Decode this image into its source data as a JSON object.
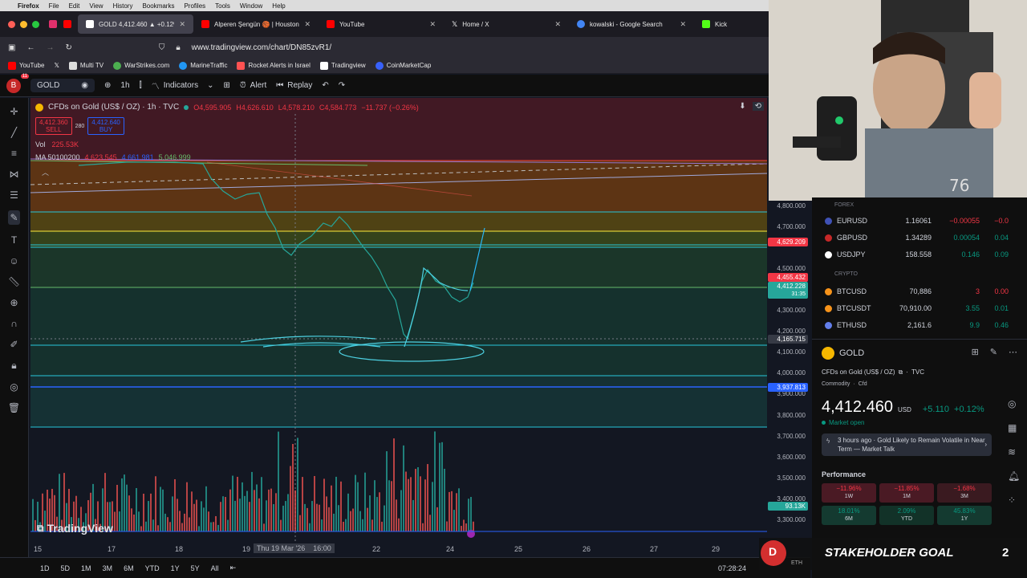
{
  "menubar": {
    "app": "Firefox",
    "items": [
      "File",
      "Edit",
      "View",
      "History",
      "Bookmarks",
      "Profiles",
      "Tools",
      "Window",
      "Help"
    ]
  },
  "tabs": [
    {
      "label": "GOLD 4,412.460 ▲ +0.12% Unn",
      "active": true,
      "color": "#ffffff"
    },
    {
      "label": "Alperen Şengün 🏀 | Houston R",
      "color": "#ff0000"
    },
    {
      "label": "YouTube",
      "color": "#ff0000"
    },
    {
      "label": "Home / X",
      "color": "#ffffff"
    },
    {
      "label": "kowalski - Google Search",
      "color": "#4285f4"
    },
    {
      "label": "Kick",
      "color": "#53fc18"
    }
  ],
  "navbar": {
    "url": "www.tradingview.com/chart/DN85zvR1/"
  },
  "bookmarks": [
    {
      "label": "YouTube",
      "color": "#ff0000"
    },
    {
      "label": "",
      "color": "#ffffff"
    },
    {
      "label": "Multi TV",
      "color": "#dddddd"
    },
    {
      "label": "WarStrikes.com",
      "color": "#4caf50"
    },
    {
      "label": "MarineTraffic",
      "color": "#2196f3"
    },
    {
      "label": "Rocket Alerts in Israel",
      "color": "#ff5252"
    },
    {
      "label": "Tradingview",
      "color": "#ffffff"
    },
    {
      "label": "CoinMarketCap",
      "color": "#3861fb"
    }
  ],
  "toolbar": {
    "avatar": "B",
    "notif": "11",
    "symbol": "GOLD",
    "interval": "1h",
    "indicators": "Indicators",
    "alert": "Alert",
    "replay": "Replay"
  },
  "legend": {
    "title": "CFDs on Gold (US$ / OZ) · 1h · TVC",
    "o": "O4,595.905",
    "h": "H4,626.610",
    "l": "L4,578.210",
    "c": "C4,584.773",
    "chg": "−11.737 (−0.26%)",
    "sell_price": "4,412.360",
    "sell_label": "SELL",
    "spread": "280",
    "buy_price": "4,412.640",
    "buy_label": "BUY",
    "vol_label": "Vol",
    "vol_value": "225.53K",
    "ma_label": "MA 50100200",
    "ma_val1": "4,623.545",
    "ma_val2": "4,661.981",
    "ma_val3": "5,046.999",
    "watermark": "TradingView"
  },
  "price_axis": {
    "labels": [
      "4,800.000",
      "4,700.000",
      "4,600.000",
      "4,500.000",
      "4,400.000",
      "4,300.000",
      "4,200.000",
      "4,100.000",
      "4,000.000",
      "3,900.000",
      "3,800.000",
      "3,700.000",
      "3,600.000",
      "3,500.000",
      "3,400.000",
      "3,300.000"
    ],
    "badge_red_top": "4,629.209",
    "badge_red": "4,455.432",
    "badge_green": "4,412.228",
    "badge_green_time": "31:35",
    "badge_grey": "4,165.715",
    "badge_blue": "3,937.813",
    "badge_vol": "93.13K"
  },
  "time_axis": {
    "labels": [
      "15",
      "17",
      "18",
      "19",
      "22",
      "24",
      "25",
      "26",
      "27",
      "29"
    ],
    "crosshair": "Thu 19 Mar '26    16:00"
  },
  "bottombar": {
    "ranges": [
      "1D",
      "5D",
      "1M",
      "3M",
      "6M",
      "YTD",
      "1Y",
      "5Y",
      "All"
    ],
    "clock": "07:28:24"
  },
  "watchlist": {
    "forex_label": "FOREX",
    "crypto_label": "CRYPTO",
    "forex": [
      {
        "sym": "EURUSD",
        "last": "1.16061",
        "chg": "−0.00055",
        "chgp": "−0.0",
        "color": "#3f51b5"
      },
      {
        "sym": "GBPUSD",
        "last": "1.34289",
        "chg": "0.00054",
        "chgp": "0.04",
        "color": "#c62828"
      },
      {
        "sym": "USDJPY",
        "last": "158.558",
        "chg": "0.146",
        "chgp": "0.09",
        "color": "#ffffff"
      }
    ],
    "crypto": [
      {
        "sym": "BTCUSD",
        "last": "70,886",
        "chg": "3",
        "chgp": "0.00",
        "color": "#f7931a"
      },
      {
        "sym": "BTCUSDT",
        "last": "70,910.00",
        "chg": "3.55",
        "chgp": "0.01",
        "color": "#f7931a"
      },
      {
        "sym": "ETHUSD",
        "last": "2,161.6",
        "chg": "9.9",
        "chgp": "0.46",
        "color": "#627eea"
      }
    ]
  },
  "details": {
    "symbol": "GOLD",
    "desc": "CFDs on Gold (US$ / OZ)",
    "exchange": "TVC",
    "type": "Commodity",
    "type2": "Cfd",
    "price": "4,412.460",
    "currency": "USD",
    "change": "+5.110",
    "change_pct": "+0.12%",
    "market": "Market open",
    "news_time": "3 hours ago",
    "news_text": "Gold Likely to Remain Volatile in Near Term — Market Talk",
    "performance_label": "Performance",
    "perf": [
      {
        "value": "−11.96%",
        "period": "1W"
      },
      {
        "value": "−11.85%",
        "period": "1M"
      },
      {
        "value": "−1.68%",
        "period": "3M"
      },
      {
        "value": "18.01%",
        "period": "6M"
      },
      {
        "value": "2.09%",
        "period": "YTD"
      },
      {
        "value": "45.83%",
        "period": "1Y"
      }
    ]
  },
  "overlay": {
    "badge": "D",
    "goal_text": "STAKEHOLDER GOAL",
    "goal_count": "2",
    "eth_label": "ETH"
  }
}
